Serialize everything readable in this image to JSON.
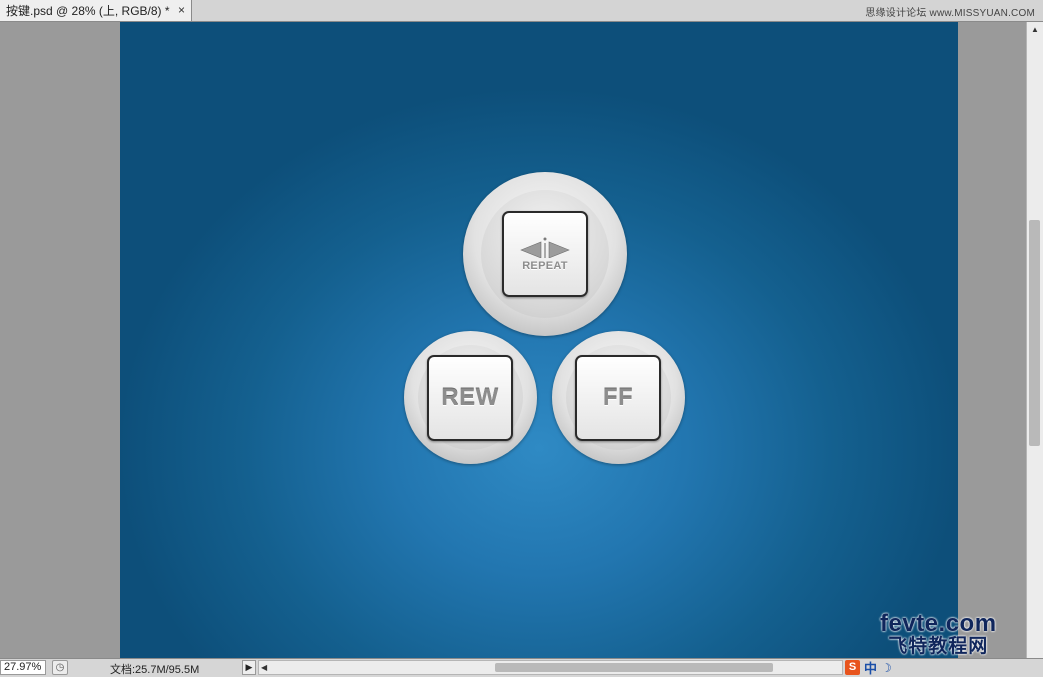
{
  "document_tab": {
    "title": "按键.psd @ 28% (上, RGB/8) *",
    "close_glyph": "×"
  },
  "watermark": "思缘设计论坛 www.MISSYUAN.COM",
  "canvas": {
    "background_color": "#1e6ea6",
    "buttons": {
      "repeat": {
        "label": "REPEAT",
        "icon": "repeat-arrows-icon"
      },
      "rew": {
        "label": "REW"
      },
      "ff": {
        "label": "FF"
      }
    }
  },
  "status_bar": {
    "zoom": "27.97%",
    "doc_info": "文档:25.7M/95.5M",
    "arrow_glyph": "▶",
    "scroll_left_glyph": "◀"
  },
  "vertical_scroll": {
    "up_glyph": "▲"
  },
  "ime_toolbar": {
    "sogou": "S",
    "lang": "中",
    "mode": "☽"
  },
  "site_logo": {
    "en": "fevte.com",
    "cn": "飞特教程网"
  }
}
